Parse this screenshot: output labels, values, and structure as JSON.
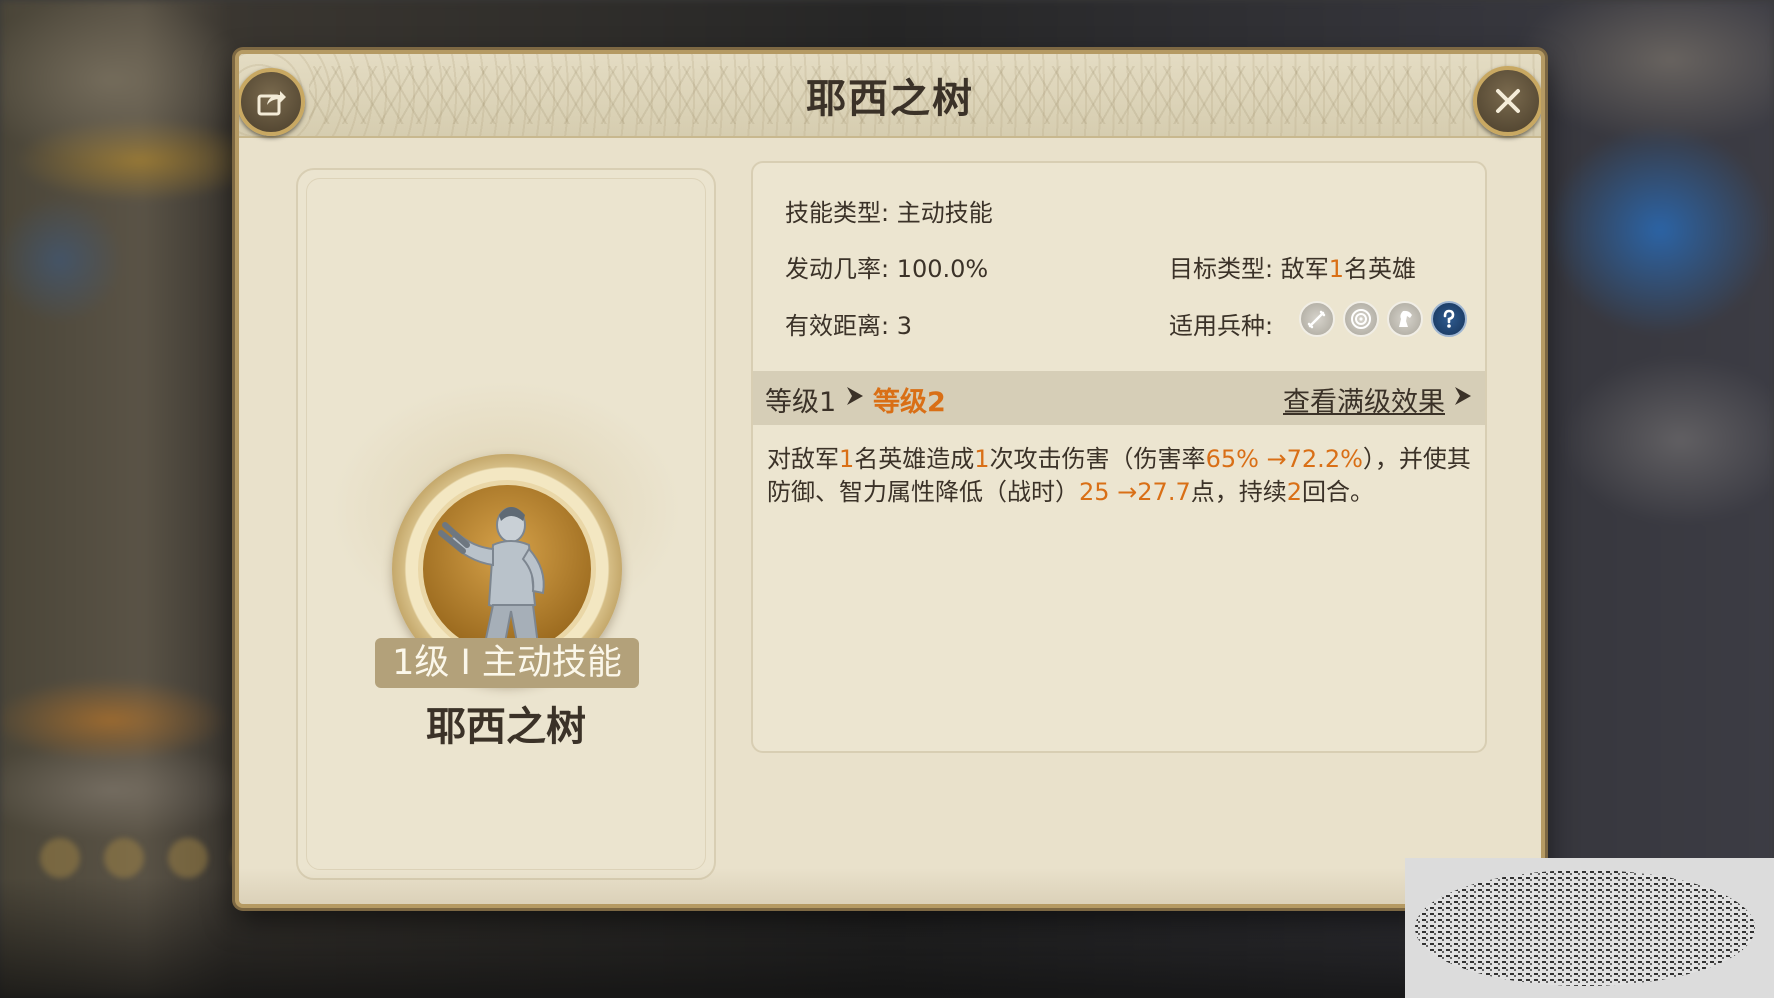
{
  "dialog": {
    "title": "耶西之树"
  },
  "skill": {
    "level_badge": "1级 I 主动技能",
    "name": "耶西之树"
  },
  "info": {
    "skill_type": "技能类型: 主动技能",
    "trigger_rate": "发动几率: 100.0%",
    "target_label": "目标类型: 敌军",
    "target_count": "1",
    "target_suffix": "名英雄",
    "range": "有效距离: 3",
    "unit_label": "适用兵种:",
    "units": [
      {
        "icon": "sword-icon",
        "active": false
      },
      {
        "icon": "bow-target-icon",
        "active": false
      },
      {
        "icon": "horse-icon",
        "active": false
      },
      {
        "icon": "question-icon",
        "active": true
      }
    ]
  },
  "level_bar": {
    "from": "等级1",
    "to": "等级2",
    "full_effect_link": "查看满级效果"
  },
  "description": {
    "p1": "对敌军",
    "n1": "1",
    "p2": "名英雄造成",
    "n2": "1",
    "p3": "次攻击伤害（伤害率",
    "n3": "65% →72.2%",
    "p4": "），并使其防御、智力属性降低（战时）",
    "n4": "25 →27.7",
    "p5": "点，持续",
    "n5": "2",
    "p6": "回合。"
  },
  "colors": {
    "highlight": "#d96f16",
    "parchment": "#e9e1cb",
    "frame_gold": "#c8a862",
    "badge_bg": "#b3a17a"
  }
}
